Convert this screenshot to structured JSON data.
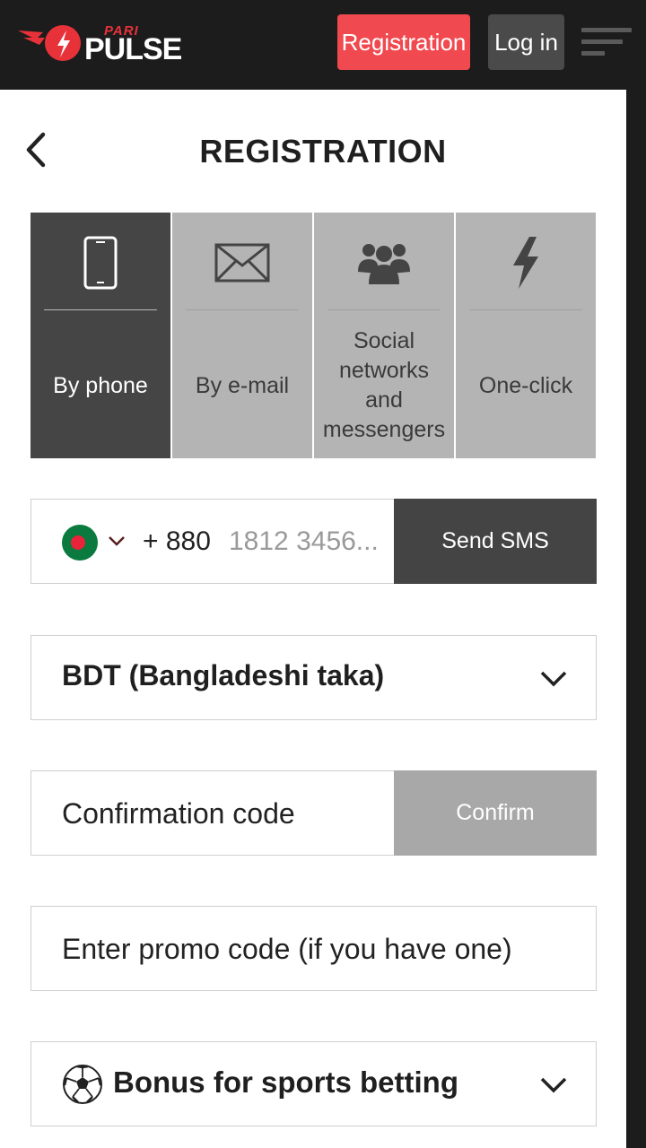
{
  "header": {
    "logo_top": "PARI",
    "logo_main": "PULSE",
    "registration_label": "Registration",
    "login_label": "Log in",
    "accent_color": "#f0494f"
  },
  "page": {
    "title": "REGISTRATION"
  },
  "tabs": [
    {
      "label": "By phone",
      "icon": "phone-icon",
      "active": true
    },
    {
      "label": "By e-mail",
      "icon": "envelope-icon",
      "active": false
    },
    {
      "label": "Social networks and messengers",
      "icon": "people-icon",
      "active": false
    },
    {
      "label": "One-click",
      "icon": "lightning-icon",
      "active": false
    }
  ],
  "phone": {
    "country_flag": "bangladesh-flag-icon",
    "dial_code": "+ 880",
    "placeholder": "1812 3456...",
    "send_sms_label": "Send SMS"
  },
  "currency": {
    "value": "BDT (Bangladeshi taka)"
  },
  "confirmation": {
    "placeholder": "Confirmation code",
    "confirm_label": "Confirm"
  },
  "promo": {
    "placeholder": "Enter promo code (if you have one)"
  },
  "bonus": {
    "label": "Bonus for sports betting",
    "icon": "soccer-ball-icon"
  }
}
